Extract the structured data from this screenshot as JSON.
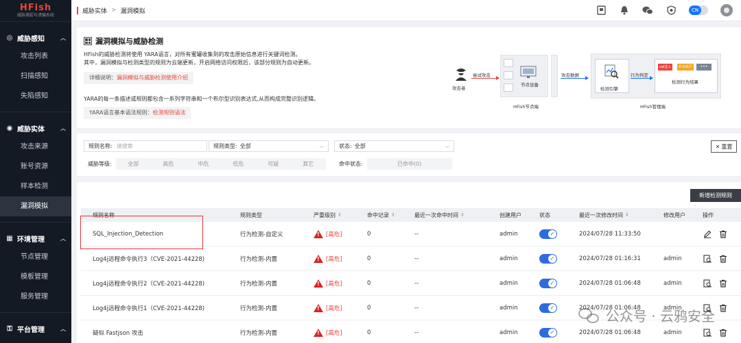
{
  "logo": {
    "title": "HFish",
    "subtitle": "威胁捕捉与诱骗系统"
  },
  "sidebar": {
    "groups": [
      {
        "title": "威胁感知",
        "icon": "radar-icon",
        "items": [
          "攻击列表",
          "扫描感知",
          "失陷感知"
        ]
      },
      {
        "title": "威胁实体",
        "icon": "target-icon",
        "items": [
          "攻击来源",
          "账号资源",
          "样本检测",
          "漏洞模拟"
        ]
      },
      {
        "title": "环境管理",
        "icon": "grid-icon",
        "items": [
          "节点管理",
          "模板管理",
          "服务管理"
        ]
      },
      {
        "title": "平台管理",
        "icon": "key-icon",
        "items": []
      }
    ],
    "active_item": "漏洞模拟"
  },
  "breadcrumb": {
    "parent": "威胁实体",
    "current": "漏洞模拟"
  },
  "topbar": {
    "lang": "CN",
    "icons": [
      "book-icon",
      "bell-icon",
      "wechat-icon",
      "shield-icon"
    ]
  },
  "intro": {
    "title": "漏洞模拟与威胁检测",
    "p1": "HFish的威胁检测将使用 YARA语言，对所有蜜罐收集到的攻击原始信息进行关键词检测。",
    "p2": "其中，漏洞模拟与检测类型的规则为云端更新，开启网络访问权限后，该部分规则为自动更新。",
    "tag1_label": "详细说明：",
    "tag1_link": "漏洞模拟与威胁检测使用介绍",
    "p3": "YARA的每一条描述或规则都包含一系列字符串和一个布尔型识别表达式,从而构成完整识别逻辑。",
    "tag2_label": "YARA语言基本语法规则：",
    "tag2_link": "检测规则语法"
  },
  "diagram": {
    "attacker": "攻击者",
    "try_attack": "尝试攻击",
    "node_device": "节点设备",
    "node_side": "HFish节点端",
    "attack_data": "攻击数据",
    "engine": "检测引擎",
    "as_judge": "行为判定",
    "result": "检测行为结果",
    "mgmt_side": "HFish管理端",
    "chip1": "sql注入",
    "chip2": "命令执行",
    "chip3": "•••"
  },
  "filter": {
    "rule_name_label": "规则名称:",
    "rule_name_placeholder": "请搜索",
    "rule_type_label": "规则类型:",
    "rule_type_value": "全部",
    "status_label": "状态:",
    "status_value": "全部",
    "level_label": "威胁等级:",
    "levels": [
      "全部",
      "高危",
      "中危",
      "低危",
      "可疑",
      "其它"
    ],
    "hit_label": "命中状态:",
    "hit_value": "已命中(0)",
    "reset": "重置"
  },
  "table": {
    "add_button": "新增检测规则",
    "headers": [
      "规则名称",
      "规则类型",
      "严重级别",
      "命中记录",
      "最近一次命中时间",
      "创建用户",
      "状态",
      "最近一次修改时间",
      "修改用户",
      "操作"
    ],
    "rows": [
      {
        "name": "SQL_Injection_Detection",
        "type": "行为检测-自定义",
        "severity": "[高危]",
        "hits": "0",
        "last_hit": "--",
        "creator": "admin",
        "enabled": true,
        "modified": "2024/07/28 11:33:50",
        "modifier": "",
        "editable": true
      },
      {
        "name": "Log4j远程命令执行3（CVE-2021-44228)",
        "type": "行为检测-内置",
        "severity": "[高危]",
        "hits": "0",
        "last_hit": "--",
        "creator": "admin",
        "enabled": true,
        "modified": "2024/07/28 01:16:31",
        "modifier": "admin",
        "editable": false
      },
      {
        "name": "Log4j远程命令执行2（CVE-2021-44228)",
        "type": "行为检测-内置",
        "severity": "[高危]",
        "hits": "0",
        "last_hit": "--",
        "creator": "admin",
        "enabled": true,
        "modified": "2024/07/28 01:06:48",
        "modifier": "admin",
        "editable": false
      },
      {
        "name": "Log4j远程命令执行1（CVE-2021-44228)",
        "type": "行为检测-内置",
        "severity": "[高危]",
        "hits": "0",
        "last_hit": "--",
        "creator": "admin",
        "enabled": true,
        "modified": "2024/07/28 01:06:48",
        "modifier": "admin",
        "editable": false
      },
      {
        "name": "疑似 Fastjson 攻击",
        "type": "行为检测-内置",
        "severity": "[高危]",
        "hits": "0",
        "last_hit": "--",
        "creator": "admin",
        "enabled": true,
        "modified": "2024/07/28 01:06:48",
        "modifier": "admin",
        "editable": false
      }
    ]
  },
  "watermark": "公众号 · 云鸦安全"
}
